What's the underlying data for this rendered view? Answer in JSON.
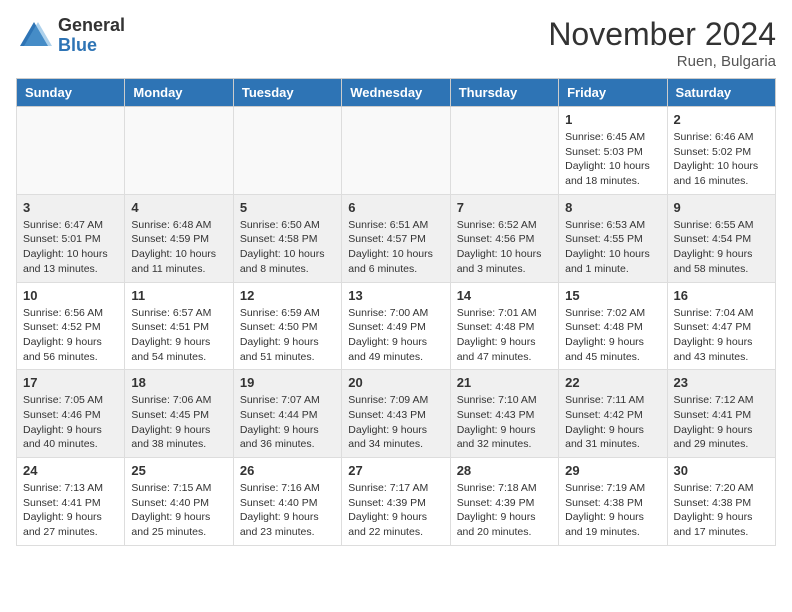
{
  "logo": {
    "general": "General",
    "blue": "Blue"
  },
  "title": "November 2024",
  "location": "Ruen, Bulgaria",
  "days": [
    "Sunday",
    "Monday",
    "Tuesday",
    "Wednesday",
    "Thursday",
    "Friday",
    "Saturday"
  ],
  "weeks": [
    [
      {
        "day": "",
        "info": ""
      },
      {
        "day": "",
        "info": ""
      },
      {
        "day": "",
        "info": ""
      },
      {
        "day": "",
        "info": ""
      },
      {
        "day": "",
        "info": ""
      },
      {
        "day": "1",
        "info": "Sunrise: 6:45 AM\nSunset: 5:03 PM\nDaylight: 10 hours and 18 minutes."
      },
      {
        "day": "2",
        "info": "Sunrise: 6:46 AM\nSunset: 5:02 PM\nDaylight: 10 hours and 16 minutes."
      }
    ],
    [
      {
        "day": "3",
        "info": "Sunrise: 6:47 AM\nSunset: 5:01 PM\nDaylight: 10 hours and 13 minutes."
      },
      {
        "day": "4",
        "info": "Sunrise: 6:48 AM\nSunset: 4:59 PM\nDaylight: 10 hours and 11 minutes."
      },
      {
        "day": "5",
        "info": "Sunrise: 6:50 AM\nSunset: 4:58 PM\nDaylight: 10 hours and 8 minutes."
      },
      {
        "day": "6",
        "info": "Sunrise: 6:51 AM\nSunset: 4:57 PM\nDaylight: 10 hours and 6 minutes."
      },
      {
        "day": "7",
        "info": "Sunrise: 6:52 AM\nSunset: 4:56 PM\nDaylight: 10 hours and 3 minutes."
      },
      {
        "day": "8",
        "info": "Sunrise: 6:53 AM\nSunset: 4:55 PM\nDaylight: 10 hours and 1 minute."
      },
      {
        "day": "9",
        "info": "Sunrise: 6:55 AM\nSunset: 4:54 PM\nDaylight: 9 hours and 58 minutes."
      }
    ],
    [
      {
        "day": "10",
        "info": "Sunrise: 6:56 AM\nSunset: 4:52 PM\nDaylight: 9 hours and 56 minutes."
      },
      {
        "day": "11",
        "info": "Sunrise: 6:57 AM\nSunset: 4:51 PM\nDaylight: 9 hours and 54 minutes."
      },
      {
        "day": "12",
        "info": "Sunrise: 6:59 AM\nSunset: 4:50 PM\nDaylight: 9 hours and 51 minutes."
      },
      {
        "day": "13",
        "info": "Sunrise: 7:00 AM\nSunset: 4:49 PM\nDaylight: 9 hours and 49 minutes."
      },
      {
        "day": "14",
        "info": "Sunrise: 7:01 AM\nSunset: 4:48 PM\nDaylight: 9 hours and 47 minutes."
      },
      {
        "day": "15",
        "info": "Sunrise: 7:02 AM\nSunset: 4:48 PM\nDaylight: 9 hours and 45 minutes."
      },
      {
        "day": "16",
        "info": "Sunrise: 7:04 AM\nSunset: 4:47 PM\nDaylight: 9 hours and 43 minutes."
      }
    ],
    [
      {
        "day": "17",
        "info": "Sunrise: 7:05 AM\nSunset: 4:46 PM\nDaylight: 9 hours and 40 minutes."
      },
      {
        "day": "18",
        "info": "Sunrise: 7:06 AM\nSunset: 4:45 PM\nDaylight: 9 hours and 38 minutes."
      },
      {
        "day": "19",
        "info": "Sunrise: 7:07 AM\nSunset: 4:44 PM\nDaylight: 9 hours and 36 minutes."
      },
      {
        "day": "20",
        "info": "Sunrise: 7:09 AM\nSunset: 4:43 PM\nDaylight: 9 hours and 34 minutes."
      },
      {
        "day": "21",
        "info": "Sunrise: 7:10 AM\nSunset: 4:43 PM\nDaylight: 9 hours and 32 minutes."
      },
      {
        "day": "22",
        "info": "Sunrise: 7:11 AM\nSunset: 4:42 PM\nDaylight: 9 hours and 31 minutes."
      },
      {
        "day": "23",
        "info": "Sunrise: 7:12 AM\nSunset: 4:41 PM\nDaylight: 9 hours and 29 minutes."
      }
    ],
    [
      {
        "day": "24",
        "info": "Sunrise: 7:13 AM\nSunset: 4:41 PM\nDaylight: 9 hours and 27 minutes."
      },
      {
        "day": "25",
        "info": "Sunrise: 7:15 AM\nSunset: 4:40 PM\nDaylight: 9 hours and 25 minutes."
      },
      {
        "day": "26",
        "info": "Sunrise: 7:16 AM\nSunset: 4:40 PM\nDaylight: 9 hours and 23 minutes."
      },
      {
        "day": "27",
        "info": "Sunrise: 7:17 AM\nSunset: 4:39 PM\nDaylight: 9 hours and 22 minutes."
      },
      {
        "day": "28",
        "info": "Sunrise: 7:18 AM\nSunset: 4:39 PM\nDaylight: 9 hours and 20 minutes."
      },
      {
        "day": "29",
        "info": "Sunrise: 7:19 AM\nSunset: 4:38 PM\nDaylight: 9 hours and 19 minutes."
      },
      {
        "day": "30",
        "info": "Sunrise: 7:20 AM\nSunset: 4:38 PM\nDaylight: 9 hours and 17 minutes."
      }
    ]
  ]
}
